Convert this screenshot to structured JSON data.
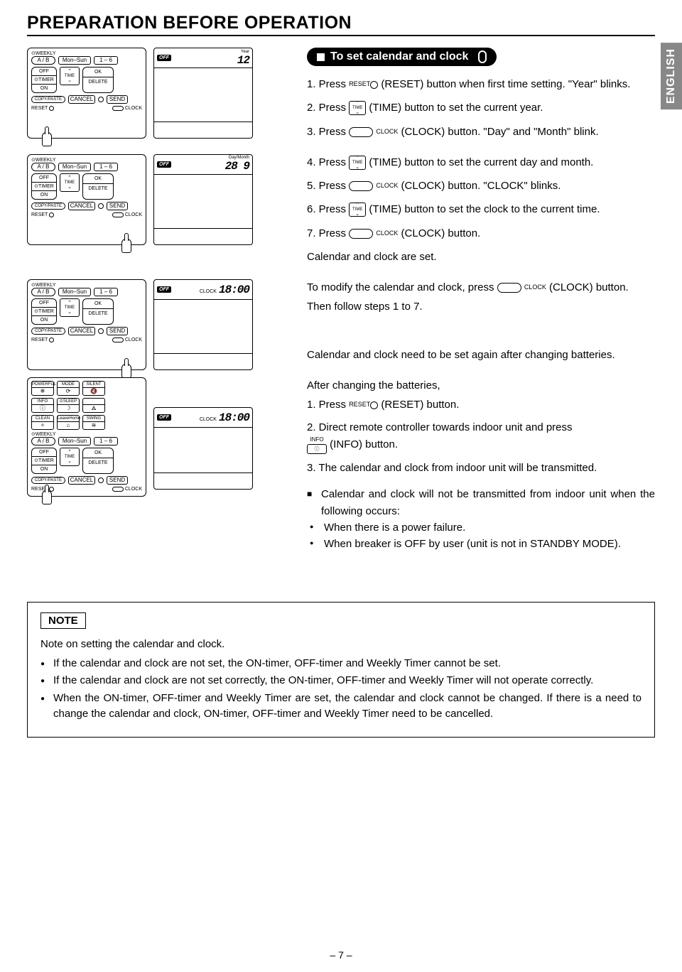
{
  "title": "PREPARATION BEFORE OPERATION",
  "language_tab": "ENGLISH",
  "section_heading": "To set calendar and clock",
  "page_number": "– 7 –",
  "remote": {
    "weekly": "WEEKLY",
    "ab": "A / B",
    "days": "Mon–Sun",
    "onesix": "1 – 6",
    "off": "OFF",
    "timer": "TIMER",
    "on": "ON",
    "time": "TIME",
    "ok": "OK",
    "delete": "DELETE",
    "copypaste": "COPY/PASTE",
    "cancel": "CANCEL",
    "send": "SEND",
    "reset": "RESET",
    "clock": "CLOCK",
    "powerful": "POWERFUL",
    "mode": "MODE",
    "silent": "SILENT",
    "info": "INFO",
    "sleep": "SLEEP",
    "clean": "CLEAN",
    "leavehome": "LeaveHome",
    "swing": "SWING"
  },
  "lcd": {
    "off": "OFF",
    "year_label": "Year",
    "year_value": "12",
    "daymonth_label": "Day/Month",
    "daymonth_value": "28  9",
    "clock_label": "CLOCK",
    "clock_value": "18:00"
  },
  "steps": {
    "s1a": "1. Press ",
    "s1b": " (RESET) button when first time setting. \"Year\" blinks.",
    "s2a": "2. Press ",
    "s2b": " (TIME) button to set the current year.",
    "s3a": "3. Press ",
    "s3b": " (CLOCK) button.   \"Day\" and \"Month\" blink.",
    "s4a": "4. Press ",
    "s4b": " (TIME) button to set the current day and month.",
    "s5a": "5. Press ",
    "s5b": " (CLOCK) button. \"CLOCK\" blinks.",
    "s6a": "6. Press ",
    "s6b": " (TIME) button to set the clock to the current time.",
    "s7a": "7. Press ",
    "s7b": " (CLOCK) button.",
    "done": "Calendar and clock are set.",
    "modify_a": "To modify the calendar and clock, press ",
    "modify_b": " (CLOCK) button.",
    "modify_c": "Then follow steps 1 to 7.",
    "battery": "Calendar and clock need to be set again after changing batteries.",
    "after_head": "After changing the batteries,",
    "a1a": "1. Press ",
    "a1b": " (RESET) button.",
    "a2a": "2. Direct remote controller towards indoor unit and press ",
    "a2b": " (INFO) button.",
    "a3": "3. The calendar and clock from indoor unit will be transmitted.",
    "warn1": "Calendar and clock will not be transmitted from indoor unit when the following occurs:",
    "warn2": "When there is a power failure.",
    "warn3": "When breaker is OFF by user (unit is not in STANDBY MODE)."
  },
  "mini_labels": {
    "reset": "RESET",
    "time": "TIME",
    "clock": "CLOCK",
    "info": "INFO"
  },
  "note": {
    "badge": "NOTE",
    "intro": "Note on setting the calendar and clock.",
    "n1": "If the calendar and clock are not set, the ON-timer, OFF-timer and Weekly Timer cannot be set.",
    "n2": "If the calendar and clock are not set correctly, the ON-timer, OFF-timer and Weekly Timer will not operate correctly.",
    "n3": "When the ON-timer, OFF-timer and Weekly Timer are set, the calendar and clock cannot be changed. If there is a need to change the calendar and clock, ON-timer, OFF-timer and Weekly Timer need to be cancelled."
  }
}
